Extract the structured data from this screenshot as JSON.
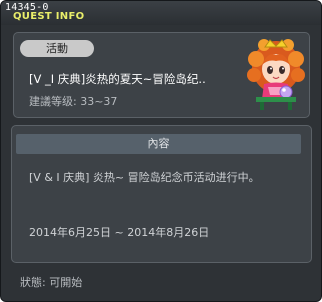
{
  "window": {
    "quest_id": "14345-0",
    "title": "QUEST INFO"
  },
  "quest": {
    "category_badge": "活動",
    "event_name": "[V _I 庆典]炎热的夏天~冒险岛纪..",
    "level_requirement": "建議等级: 33~37",
    "npc_icon": "npc-girl-avatar"
  },
  "content": {
    "header": "內容",
    "description": "[V & I 庆典] 炎热~ 冒险岛纪念币活动进行中。",
    "date_range": "2014年6月25日 ~ 2014年8月26日"
  },
  "status": {
    "text": "狀態: 可開始"
  },
  "colors": {
    "title_yellow": "#e9ee6a",
    "window_bg": "#2e3236",
    "panel_bg": "#3d4247",
    "header_bar": "#56616b"
  }
}
